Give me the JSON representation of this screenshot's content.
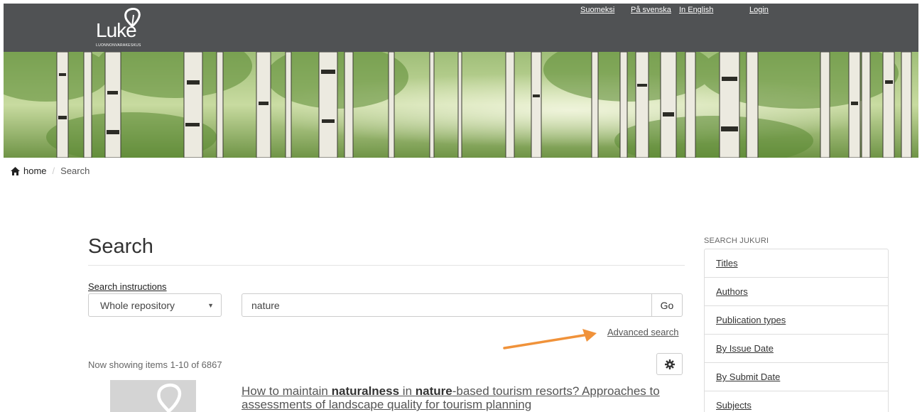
{
  "header": {
    "logo_text": "Luke",
    "logo_subtitle": "LUONNONVARAKESKUS",
    "links": [
      {
        "label": "Suomeksi"
      },
      {
        "label": "På svenska"
      },
      {
        "label": "In English"
      },
      {
        "label": "Login"
      }
    ]
  },
  "breadcrumb": {
    "home": "home",
    "separator": "/",
    "current": "Search"
  },
  "main": {
    "title": "Search",
    "instructions_link": "Search instructions",
    "scope_select": "Whole repository",
    "query_value": "nature",
    "go_label": "Go",
    "advanced_search": "Advanced search",
    "results_count": "Now showing items 1-10 of 6867",
    "result": {
      "parts": [
        {
          "t": "How to maintain ",
          "b": false
        },
        {
          "t": "naturalness",
          "b": true
        },
        {
          "t": " in ",
          "b": false
        },
        {
          "t": "nature",
          "b": true
        },
        {
          "t": "-based tourism resorts? Approaches to assessments of landscape quality for tourism planning",
          "b": false
        }
      ]
    }
  },
  "sidebar": {
    "heading": "SEARCH JUKURI",
    "items": [
      {
        "label": "Titles"
      },
      {
        "label": "Authors"
      },
      {
        "label": "Publication types"
      },
      {
        "label": "By Issue Date"
      },
      {
        "label": "By Submit Date"
      },
      {
        "label": "Subjects"
      }
    ]
  },
  "colors": {
    "topbar": "#505254",
    "annotation_arrow": "#f0923a"
  },
  "icons": {
    "home": "home-icon",
    "caret": "caret-down-icon",
    "gear": "gear-icon"
  }
}
